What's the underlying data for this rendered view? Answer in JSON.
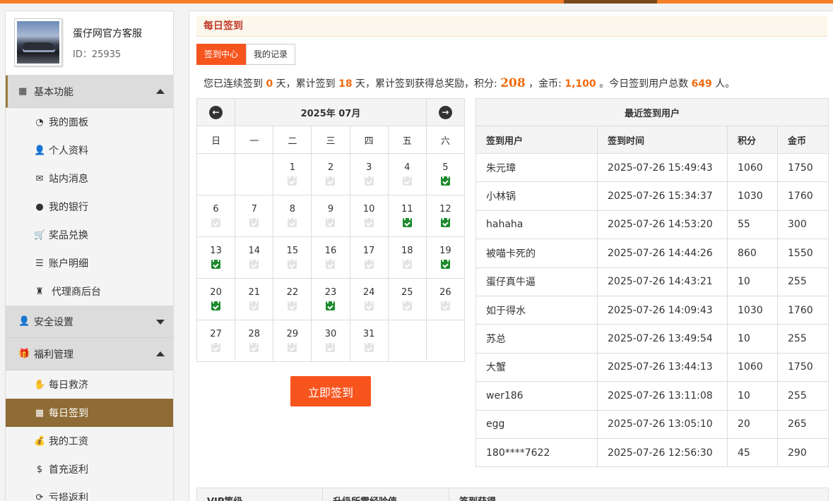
{
  "profile": {
    "name": "蛋仔网官方客服",
    "id_label": "ID：25935"
  },
  "sidebar": {
    "groups": [
      {
        "label": "基本功能",
        "items": [
          "我的面板",
          "个人资料",
          "站内消息",
          "我的银行",
          "奖品兑换",
          "账户明细",
          "代理商后台"
        ]
      },
      {
        "label": "安全设置",
        "items": []
      },
      {
        "label": "福利管理",
        "items": [
          "每日救济",
          "每日签到",
          "我的工资",
          "首充返利",
          "亏损返利"
        ]
      }
    ]
  },
  "page": {
    "title": "每日签到"
  },
  "tabs": [
    "签到中心",
    "我的记录"
  ],
  "summary": {
    "p1": "您已连续签到",
    "consecutive": "0",
    "p2": "天，累计签到",
    "total_days": "18",
    "p3": "天，累计签到获得总奖励，积分:",
    "points": "208",
    "p4": "，金币:",
    "coins": "1,100",
    "p5": "。今日签到用户总数",
    "today_count": "649",
    "p6": "人。"
  },
  "calendar": {
    "month_label": "2025年 07月",
    "weekdays": [
      "日",
      "一",
      "二",
      "三",
      "四",
      "五",
      "六"
    ],
    "weeks": [
      [
        null,
        null,
        {
          "d": "1",
          "s": false
        },
        {
          "d": "2",
          "s": false
        },
        {
          "d": "3",
          "s": false
        },
        {
          "d": "4",
          "s": false
        },
        {
          "d": "5",
          "s": true
        }
      ],
      [
        {
          "d": "6",
          "s": false
        },
        {
          "d": "7",
          "s": false
        },
        {
          "d": "8",
          "s": false
        },
        {
          "d": "9",
          "s": false
        },
        {
          "d": "10",
          "s": false
        },
        {
          "d": "11",
          "s": true
        },
        {
          "d": "12",
          "s": true
        }
      ],
      [
        {
          "d": "13",
          "s": true
        },
        {
          "d": "14",
          "s": false
        },
        {
          "d": "15",
          "s": false
        },
        {
          "d": "16",
          "s": false
        },
        {
          "d": "17",
          "s": false
        },
        {
          "d": "18",
          "s": false
        },
        {
          "d": "19",
          "s": true
        }
      ],
      [
        {
          "d": "20",
          "s": true
        },
        {
          "d": "21",
          "s": false
        },
        {
          "d": "22",
          "s": false
        },
        {
          "d": "23",
          "s": true
        },
        {
          "d": "24",
          "s": false
        },
        {
          "d": "25",
          "s": false
        },
        {
          "d": "26",
          "s": false
        }
      ],
      [
        {
          "d": "27",
          "s": false
        },
        {
          "d": "28",
          "s": false
        },
        {
          "d": "29",
          "s": false
        },
        {
          "d": "30",
          "s": false
        },
        {
          "d": "31",
          "s": false
        },
        null,
        null
      ]
    ],
    "signed_color": "#1c8a2c"
  },
  "sign_button": "立即签到",
  "recent": {
    "caption": "最近签到用户",
    "columns": [
      "签到用户",
      "签到时间",
      "积分",
      "金币"
    ],
    "rows": [
      [
        "朱元璋",
        "2025-07-26 15:49:43",
        "1060",
        "1750"
      ],
      [
        "小林锅",
        "2025-07-26 15:34:37",
        "1030",
        "1760"
      ],
      [
        "hahaha",
        "2025-07-26 14:53:20",
        "55",
        "300"
      ],
      [
        "被喵卡死的",
        "2025-07-26 14:44:26",
        "860",
        "1550"
      ],
      [
        "蛋仔真牛逼",
        "2025-07-26 14:43:21",
        "10",
        "255"
      ],
      [
        "如于得水",
        "2025-07-26 14:09:43",
        "1030",
        "1760"
      ],
      [
        "苏总",
        "2025-07-26 13:49:54",
        "10",
        "255"
      ],
      [
        "大蟹",
        "2025-07-26 13:44:13",
        "1060",
        "1750"
      ],
      [
        "wer186",
        "2025-07-26 13:11:08",
        "10",
        "255"
      ],
      [
        "egg",
        "2025-07-26 13:05:10",
        "20",
        "265"
      ],
      [
        "180****7622",
        "2025-07-26 12:56:30",
        "45",
        "290"
      ]
    ]
  },
  "vip_table": {
    "columns": [
      "VIP等级",
      "升级所需经验值",
      "签到获得"
    ]
  },
  "colors": {
    "accent": "#f8541e",
    "sidebar_selected": "#8f6c36",
    "top_bar": "#f47f2a"
  }
}
